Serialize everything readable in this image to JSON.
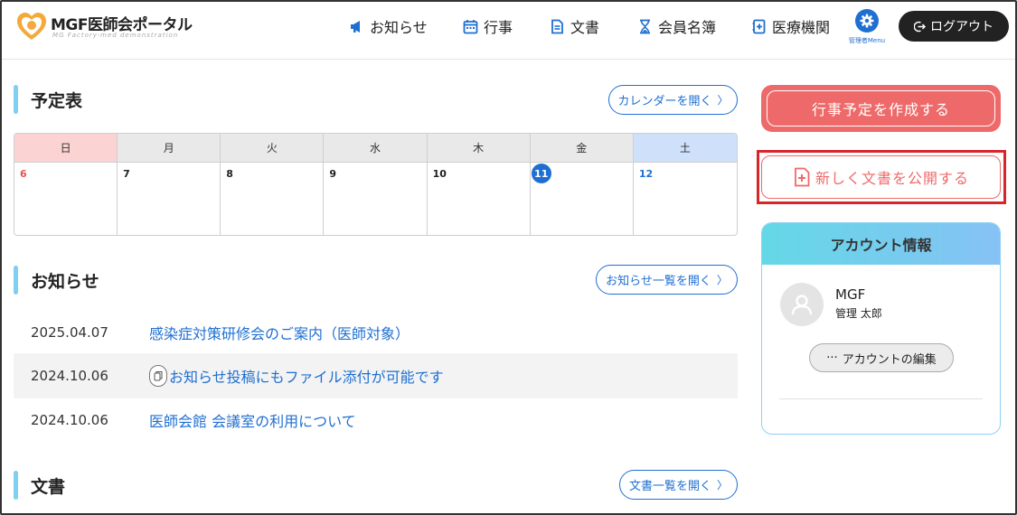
{
  "header": {
    "logo_title": "MGF医師会ポータル",
    "logo_sub": "MG Factory-med demonstration",
    "nav": {
      "notice": "お知らせ",
      "event": "行事",
      "document": "文書",
      "member": "会員名簿",
      "medical": "医療機関"
    },
    "admin_label": "管理者Menu",
    "logout_label": "ログアウト"
  },
  "schedule": {
    "title": "予定表",
    "open_calendar": "カレンダーを開く",
    "weekdays": [
      "日",
      "月",
      "火",
      "水",
      "木",
      "金",
      "土"
    ],
    "days": [
      "6",
      "7",
      "8",
      "9",
      "10",
      "11",
      "12"
    ],
    "today": "11"
  },
  "notices": {
    "title": "お知らせ",
    "open_list": "お知らせ一覧を開く",
    "items": [
      {
        "date": "2025.04.07",
        "title": "感染症対策研修会のご案内（医師対象）"
      },
      {
        "date": "2024.10.06",
        "title": "お知らせ投稿にもファイル添付が可能です"
      },
      {
        "date": "2024.10.06",
        "title": "医師会館 会議室の利用について"
      }
    ]
  },
  "documents": {
    "title": "文書",
    "open_list": "文書一覧を開く"
  },
  "sidebar": {
    "create_event": "行事予定を作成する",
    "publish_document": "新しく文書を公開する",
    "account": {
      "title": "アカウント情報",
      "name": "MGF",
      "user": "管理 太郎",
      "edit": "アカウントの編集"
    }
  },
  "colors": {
    "accent_blue": "#1f6fd1",
    "accent_red": "#ee6a6a",
    "highlight_red": "#d8252a",
    "section_bar": "#7fd0f0"
  }
}
